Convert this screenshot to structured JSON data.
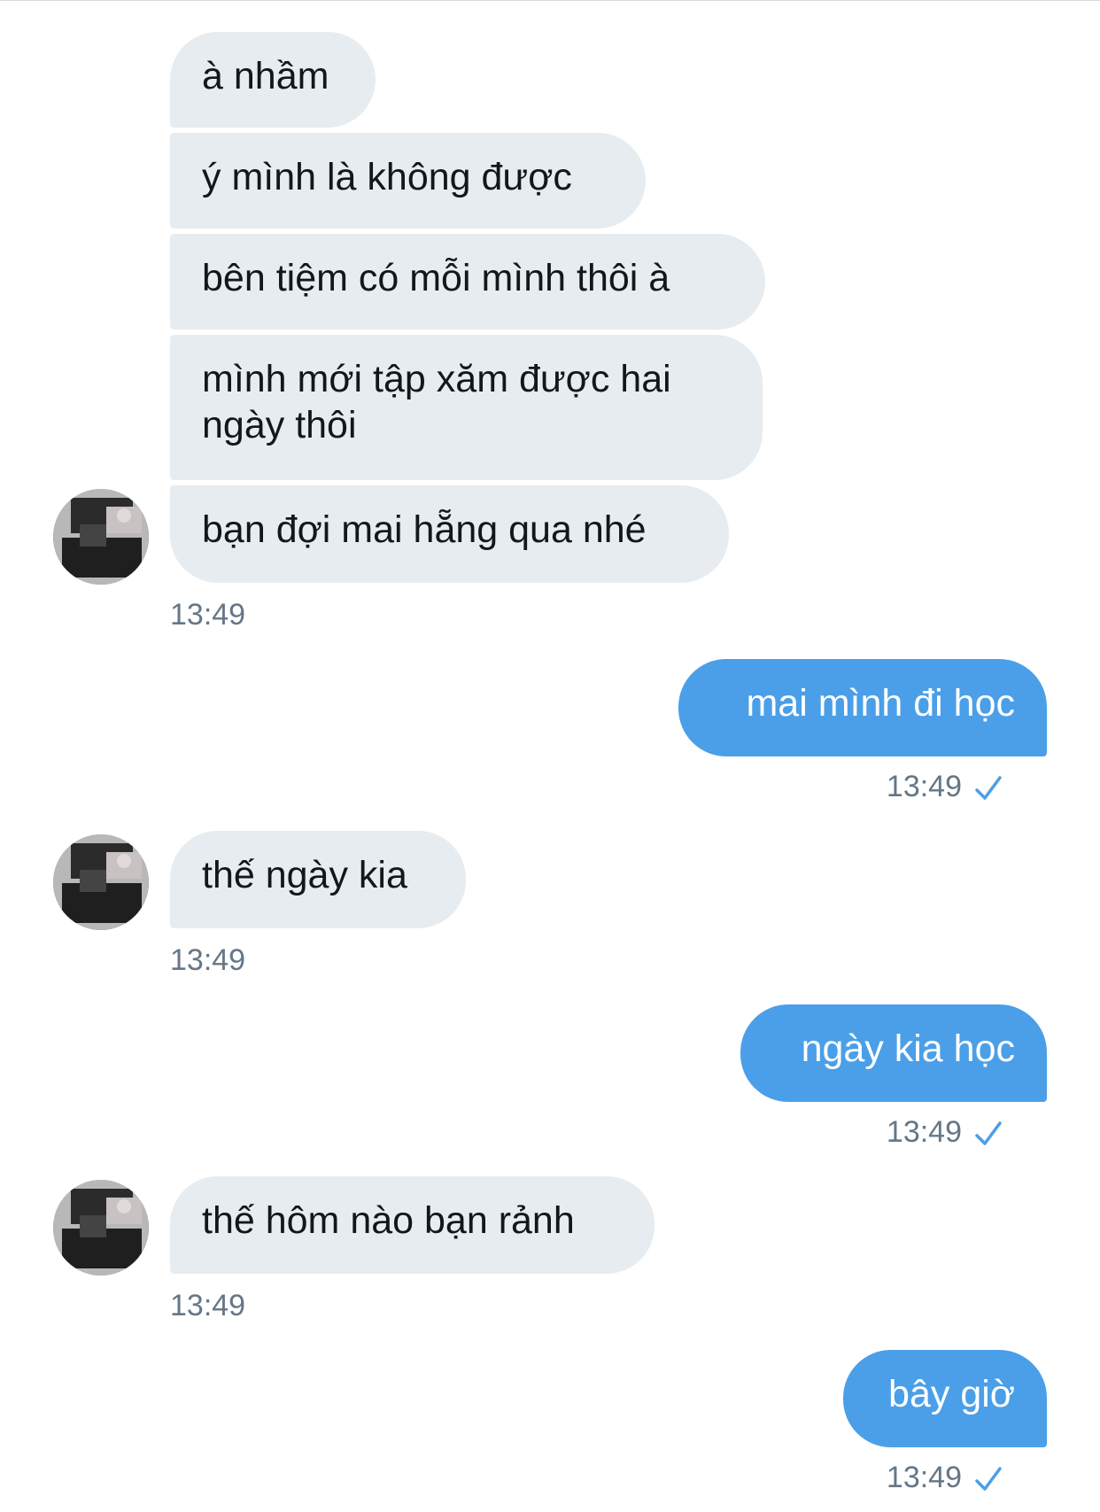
{
  "conversation": {
    "messages": [
      {
        "side": "in",
        "text": "à nhầm"
      },
      {
        "side": "in",
        "text": "ý mình là không được"
      },
      {
        "side": "in",
        "text": "bên tiệm có mỗi mình thôi à"
      },
      {
        "side": "in",
        "text_line1": "mình mới tập xăm được hai",
        "text_line2": "ngày thôi"
      },
      {
        "side": "in",
        "text": "bạn đợi mai hẵng qua nhé",
        "time": "13:49"
      },
      {
        "side": "out",
        "text": "mai mình đi học",
        "time": "13:49",
        "status": "read-check-icon"
      },
      {
        "side": "in",
        "text": "thế ngày kia",
        "time": "13:49"
      },
      {
        "side": "out",
        "text": "ngày kia học",
        "time": "13:49",
        "status": "read-check-icon"
      },
      {
        "side": "in",
        "text": "thế hôm nào bạn rảnh",
        "time": "13:49"
      },
      {
        "side": "out",
        "text": "bây giờ",
        "time": "13:49",
        "status": "read-check-icon"
      }
    ]
  },
  "colors": {
    "incoming_bubble": "#e6ecf0",
    "outgoing_bubble": "#4a9fe8",
    "timestamp": "#657786",
    "check": "#4a9fe8"
  }
}
